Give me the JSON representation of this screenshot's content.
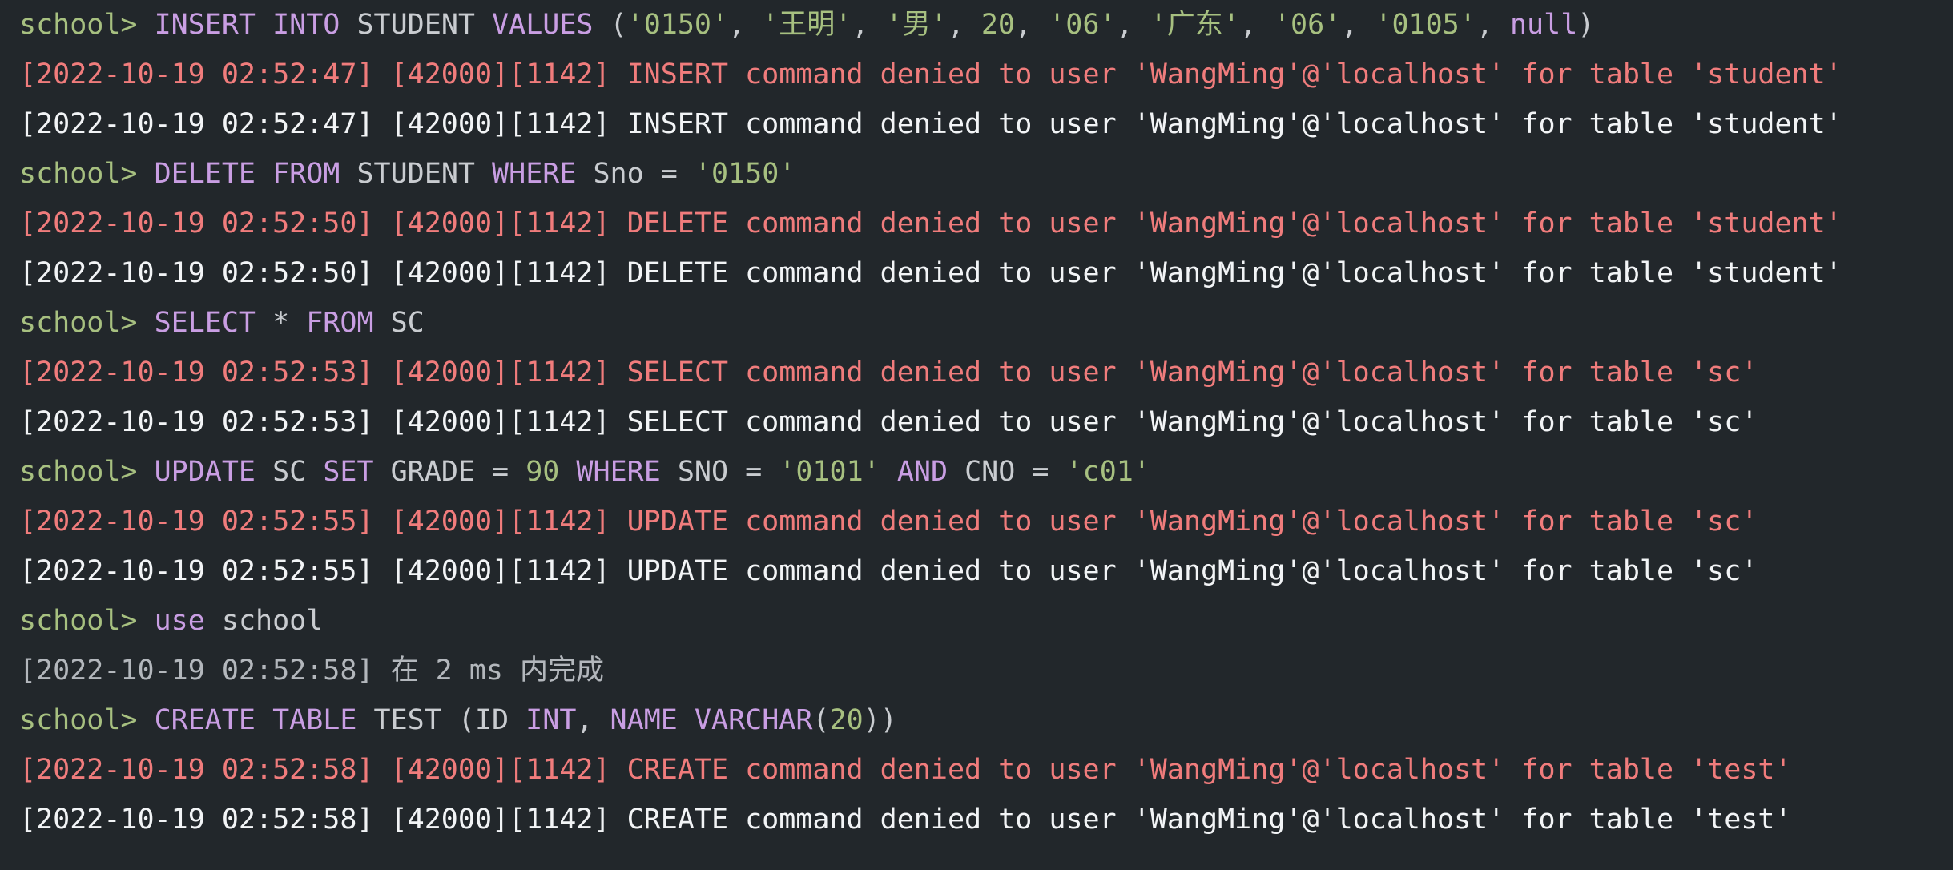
{
  "console": {
    "prompt": "school> ",
    "lines": [
      {
        "kind": "cmd",
        "tokens": [
          {
            "t": "kw",
            "v": "INSERT"
          },
          {
            "t": "id",
            "v": " "
          },
          {
            "t": "kw",
            "v": "INTO"
          },
          {
            "t": "id",
            "v": " STUDENT "
          },
          {
            "t": "kw",
            "v": "VALUES"
          },
          {
            "t": "punct",
            "v": " ("
          },
          {
            "t": "str",
            "v": "'0150'"
          },
          {
            "t": "punct",
            "v": ", "
          },
          {
            "t": "str",
            "v": "'王明'"
          },
          {
            "t": "punct",
            "v": ", "
          },
          {
            "t": "str",
            "v": "'男'"
          },
          {
            "t": "punct",
            "v": ", "
          },
          {
            "t": "num",
            "v": "20"
          },
          {
            "t": "punct",
            "v": ", "
          },
          {
            "t": "str",
            "v": "'06'"
          },
          {
            "t": "punct",
            "v": ", "
          },
          {
            "t": "str",
            "v": "'广东'"
          },
          {
            "t": "punct",
            "v": ", "
          },
          {
            "t": "str",
            "v": "'06'"
          },
          {
            "t": "punct",
            "v": ", "
          },
          {
            "t": "str",
            "v": "'0105'"
          },
          {
            "t": "punct",
            "v": ", "
          },
          {
            "t": "kw",
            "v": "null"
          },
          {
            "t": "punct",
            "v": ")"
          }
        ]
      },
      {
        "kind": "err",
        "text": "[2022-10-19 02:52:47] [42000][1142] INSERT command denied to user 'WangMing'@'localhost' for table 'student'"
      },
      {
        "kind": "out",
        "text": "[2022-10-19 02:52:47] [42000][1142] INSERT command denied to user 'WangMing'@'localhost' for table 'student'"
      },
      {
        "kind": "cmd",
        "tokens": [
          {
            "t": "kw",
            "v": "DELETE"
          },
          {
            "t": "id",
            "v": " "
          },
          {
            "t": "kw",
            "v": "FROM"
          },
          {
            "t": "id",
            "v": " STUDENT "
          },
          {
            "t": "kw",
            "v": "WHERE"
          },
          {
            "t": "id",
            "v": " Sno = "
          },
          {
            "t": "str",
            "v": "'0150'"
          }
        ]
      },
      {
        "kind": "err",
        "text": "[2022-10-19 02:52:50] [42000][1142] DELETE command denied to user 'WangMing'@'localhost' for table 'student'"
      },
      {
        "kind": "out",
        "text": "[2022-10-19 02:52:50] [42000][1142] DELETE command denied to user 'WangMing'@'localhost' for table 'student'"
      },
      {
        "kind": "cmd",
        "tokens": [
          {
            "t": "kw",
            "v": "SELECT"
          },
          {
            "t": "id",
            "v": " * "
          },
          {
            "t": "kw",
            "v": "FROM"
          },
          {
            "t": "id",
            "v": " SC"
          }
        ]
      },
      {
        "kind": "err",
        "text": "[2022-10-19 02:52:53] [42000][1142] SELECT command denied to user 'WangMing'@'localhost' for table 'sc'"
      },
      {
        "kind": "out",
        "text": "[2022-10-19 02:52:53] [42000][1142] SELECT command denied to user 'WangMing'@'localhost' for table 'sc'"
      },
      {
        "kind": "cmd",
        "tokens": [
          {
            "t": "kw",
            "v": "UPDATE"
          },
          {
            "t": "id",
            "v": " SC "
          },
          {
            "t": "kw",
            "v": "SET"
          },
          {
            "t": "id",
            "v": " GRADE = "
          },
          {
            "t": "num",
            "v": "90"
          },
          {
            "t": "id",
            "v": " "
          },
          {
            "t": "kw",
            "v": "WHERE"
          },
          {
            "t": "id",
            "v": " SNO = "
          },
          {
            "t": "str",
            "v": "'0101'"
          },
          {
            "t": "id",
            "v": " "
          },
          {
            "t": "kw",
            "v": "AND"
          },
          {
            "t": "id",
            "v": " CNO = "
          },
          {
            "t": "str",
            "v": "'c01'"
          }
        ]
      },
      {
        "kind": "err",
        "text": "[2022-10-19 02:52:55] [42000][1142] UPDATE command denied to user 'WangMing'@'localhost' for table 'sc'"
      },
      {
        "kind": "out",
        "text": "[2022-10-19 02:52:55] [42000][1142] UPDATE command denied to user 'WangMing'@'localhost' for table 'sc'"
      },
      {
        "kind": "cmd",
        "tokens": [
          {
            "t": "kw",
            "v": "use"
          },
          {
            "t": "id",
            "v": " school"
          }
        ]
      },
      {
        "kind": "info",
        "text": "[2022-10-19 02:52:58] 在 2 ms 内完成"
      },
      {
        "kind": "cmd",
        "tokens": [
          {
            "t": "kw",
            "v": "CREATE"
          },
          {
            "t": "id",
            "v": " "
          },
          {
            "t": "kw",
            "v": "TABLE"
          },
          {
            "t": "id",
            "v": " TEST (ID "
          },
          {
            "t": "kw",
            "v": "INT"
          },
          {
            "t": "punct",
            "v": ", "
          },
          {
            "t": "kw",
            "v": "NAME"
          },
          {
            "t": "id",
            "v": " "
          },
          {
            "t": "kw",
            "v": "VARCHAR"
          },
          {
            "t": "punct",
            "v": "("
          },
          {
            "t": "num",
            "v": "20"
          },
          {
            "t": "punct",
            "v": "))"
          }
        ]
      },
      {
        "kind": "err",
        "text": "[2022-10-19 02:52:58] [42000][1142] CREATE command denied to user 'WangMing'@'localhost' for table 'test'"
      },
      {
        "kind": "out",
        "text": "[2022-10-19 02:52:58] [42000][1142] CREATE command denied to user 'WangMing'@'localhost' for table 'test'"
      }
    ]
  },
  "colors": {
    "background": "#22272b",
    "prompt": "#a7c080",
    "keyword": "#c99ee3",
    "string": "#a7c080",
    "error": "#f07c7c",
    "output": "#f2f4f6",
    "info": "#b3b7bc"
  }
}
